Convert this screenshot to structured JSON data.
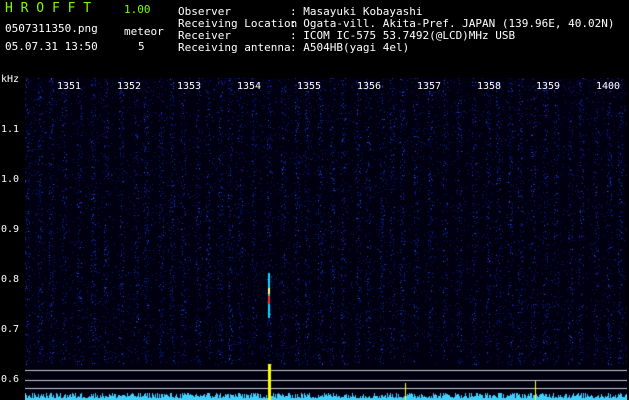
{
  "app": {
    "title_letters": "H R O F F T",
    "version": "1.00",
    "filename": "0507311350.png",
    "mode": "meteor",
    "timestamp": "05.07.31 13:50",
    "count": "5"
  },
  "info": {
    "labels": [
      "Observer",
      "Receiving Location",
      "Receiver",
      "Receiving antenna"
    ],
    "values": [
      ": Masayuki Kobayashi",
      ": Ogata-vill. Akita-Pref. JAPAN (139.96E, 40.02N)",
      ": ICOM IC-575 53.7492(@LCD)MHz USB",
      ": A504HB(yagi 4el)"
    ]
  },
  "chart_data": {
    "type": "heatmap",
    "yunit": "kHz",
    "yticks": [
      "1.1",
      "1.0",
      "0.9",
      "0.8",
      "0.7",
      "0.6"
    ],
    "xticks": [
      "1351",
      "1352",
      "1353",
      "1354",
      "1355",
      "1356",
      "1357",
      "1358",
      "1359",
      "1400"
    ],
    "colors": {
      "background": "#000010",
      "noise_low": "#0a1a8c",
      "noise_high": "#2a5cff",
      "grid_lines": "#c8c8c8",
      "spectrum": "#3fd0ff",
      "marker": "#ffff00"
    }
  }
}
